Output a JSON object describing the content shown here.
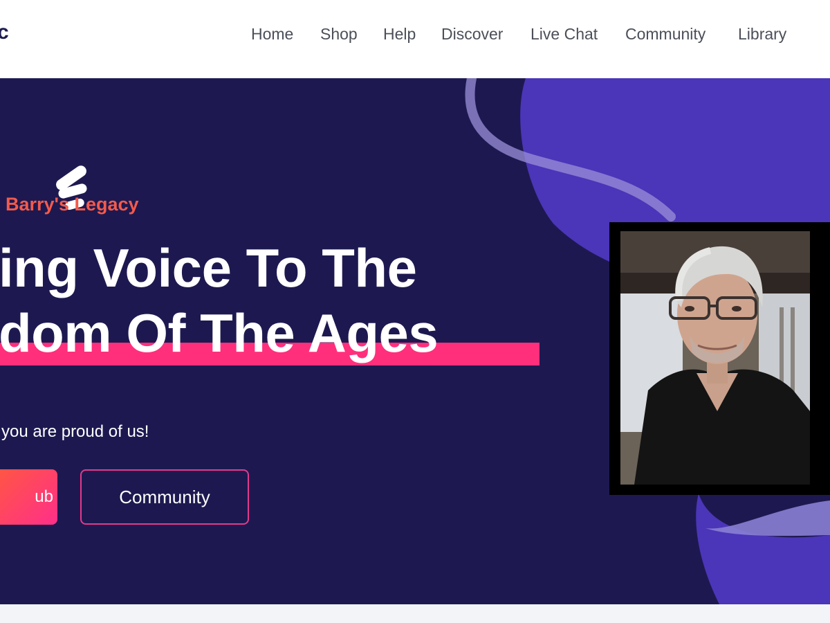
{
  "header": {
    "logo_fragment": "c",
    "nav": [
      {
        "label": "Home"
      },
      {
        "label": "Shop"
      },
      {
        "label": "Help"
      },
      {
        "label": "Discover"
      },
      {
        "label": "Live Chat"
      },
      {
        "label": "Community"
      },
      {
        "label": "Library"
      }
    ]
  },
  "hero": {
    "brand": "Barry's Legacy",
    "headline_line1": "ing Voice To The",
    "headline_line2": "dom Of The Ages",
    "tagline": "you are proud of us!",
    "primary_button": "ub",
    "secondary_button": "Community",
    "photo_alt": "Portrait of a grey-haired man with glasses in a black shirt"
  },
  "colors": {
    "hero_bg": "#1d1950",
    "accent_pink": "#ff2f7c",
    "brand_orange": "#f25a4c",
    "blob_purple": "#4b35b8"
  }
}
